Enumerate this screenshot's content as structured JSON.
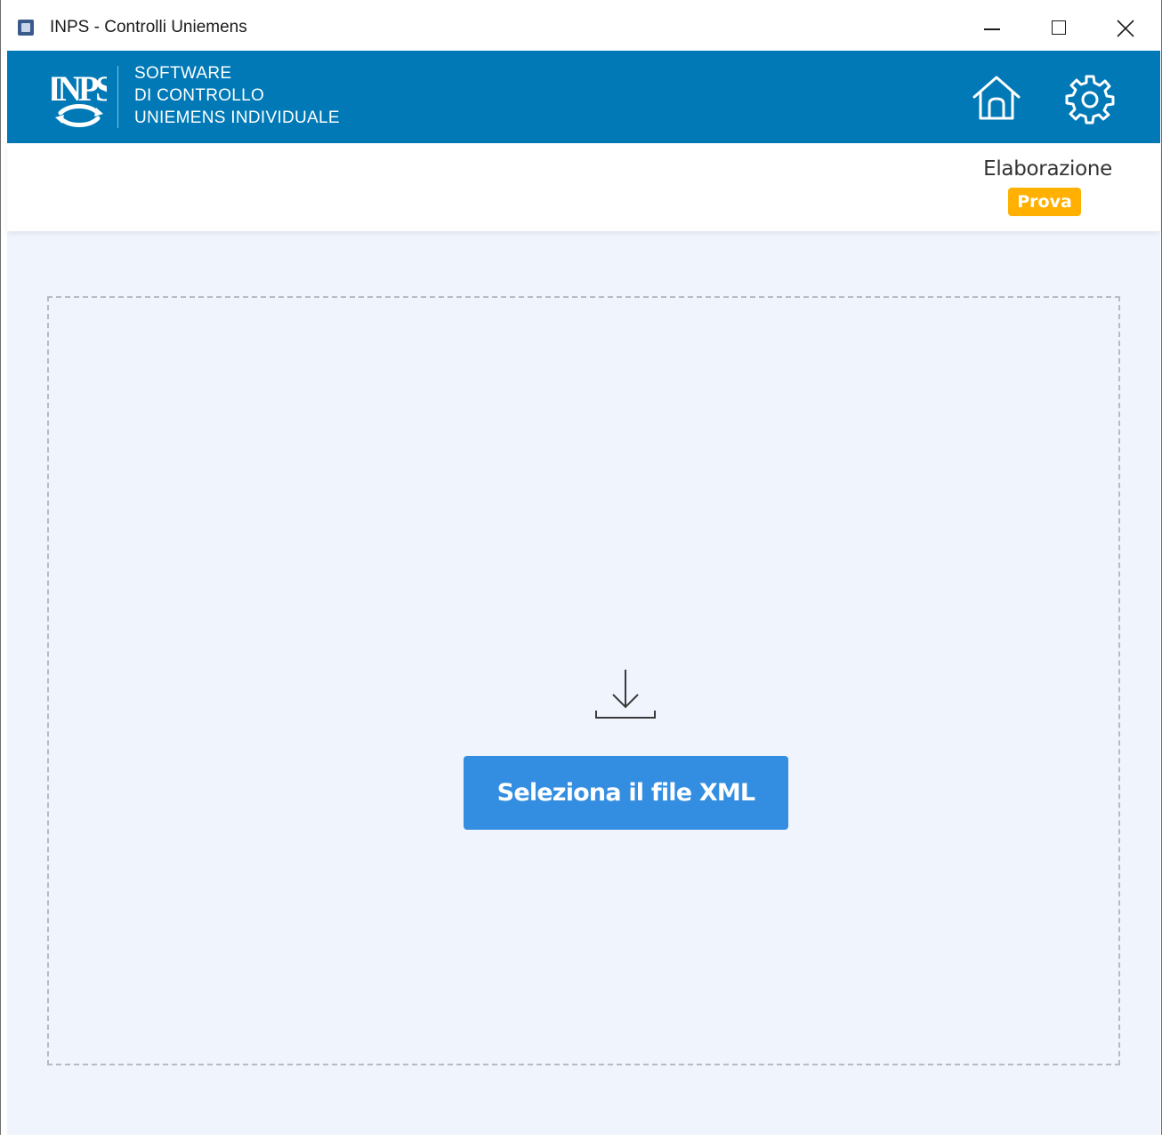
{
  "window": {
    "title": "INPS - Controlli Uniemens",
    "controls": [
      "minimize",
      "maximize",
      "close"
    ]
  },
  "header": {
    "logo_text": "INPS",
    "brand_lines": [
      "SOFTWARE",
      "DI CONTROLLO",
      "UNIEMENS INDIVIDUALE"
    ],
    "icons": [
      "home-icon",
      "gear-icon"
    ],
    "background_color": "#0079b6"
  },
  "status": {
    "label": "Elaborazione",
    "badge": "Prova",
    "badge_color": "#ffb000"
  },
  "dropzone": {
    "icon": "download-icon",
    "button_label": "Seleziona il file XML",
    "button_color": "#338ee1",
    "background_color": "#eff4fd"
  }
}
